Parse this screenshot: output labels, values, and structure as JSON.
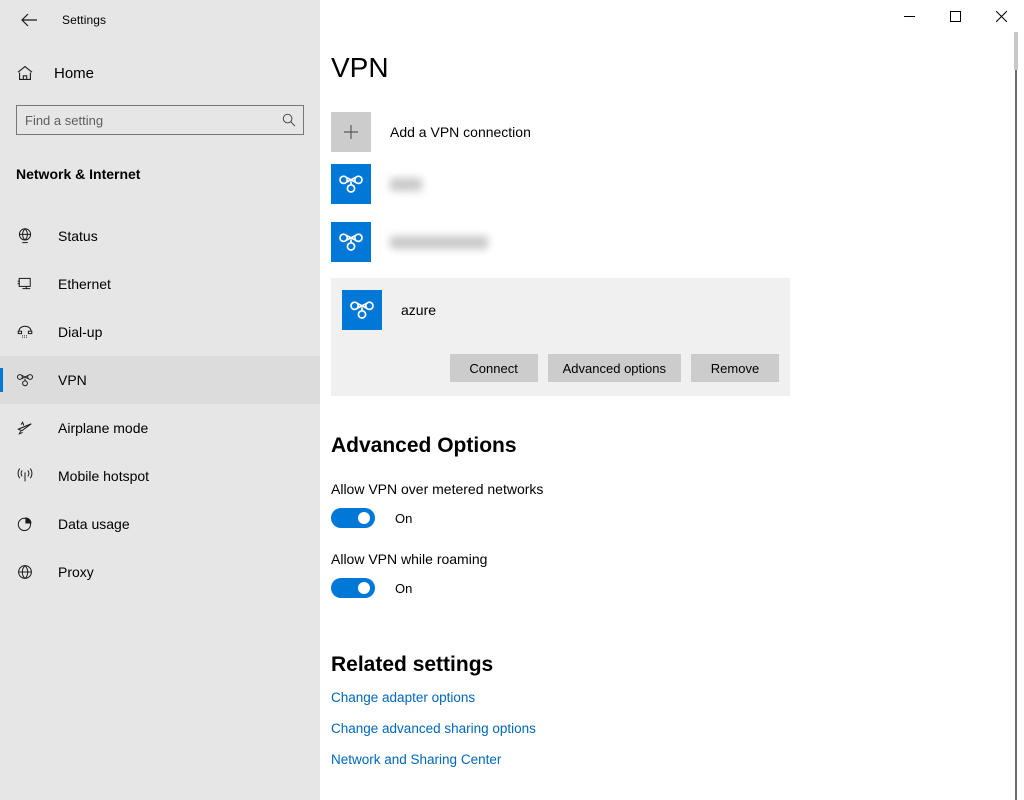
{
  "window": {
    "app_title": "Settings",
    "back_icon": "back-arrow-icon",
    "controls": {
      "minimize_label": "Minimize",
      "maximize_label": "Maximize",
      "close_label": "Close"
    }
  },
  "sidebar": {
    "home": {
      "label": "Home",
      "icon": "home-icon"
    },
    "search": {
      "placeholder": "Find a setting",
      "value": "",
      "icon": "search-icon"
    },
    "category": "Network & Internet",
    "items": [
      {
        "label": "Status",
        "icon": "status-globe-icon",
        "selected": false
      },
      {
        "label": "Ethernet",
        "icon": "ethernet-icon",
        "selected": false
      },
      {
        "label": "Dial-up",
        "icon": "dialup-phone-icon",
        "selected": false
      },
      {
        "label": "VPN",
        "icon": "vpn-knot-icon",
        "selected": true
      },
      {
        "label": "Airplane mode",
        "icon": "airplane-icon",
        "selected": false
      },
      {
        "label": "Mobile hotspot",
        "icon": "hotspot-signal-icon",
        "selected": false
      },
      {
        "label": "Data usage",
        "icon": "pie-chart-icon",
        "selected": false
      },
      {
        "label": "Proxy",
        "icon": "globe-icon",
        "selected": false
      }
    ]
  },
  "main": {
    "page_title": "VPN",
    "add_connection": {
      "label": "Add a VPN connection",
      "icon": "plus-icon"
    },
    "connections": [
      {
        "name": "",
        "redacted": true,
        "icon": "vpn-knot-icon",
        "selected": false
      },
      {
        "name": "",
        "redacted": true,
        "icon": "vpn-knot-icon",
        "selected": false
      },
      {
        "name": "azure",
        "redacted": false,
        "icon": "vpn-knot-icon",
        "selected": true
      }
    ],
    "selected_actions": {
      "connect": "Connect",
      "advanced_options": "Advanced options",
      "remove": "Remove"
    },
    "advanced_options": {
      "title": "Advanced Options",
      "toggles": [
        {
          "label": "Allow VPN over metered networks",
          "state": "On",
          "on": true
        },
        {
          "label": "Allow VPN while roaming",
          "state": "On",
          "on": true
        }
      ]
    },
    "related_settings": {
      "title": "Related settings",
      "links": [
        "Change adapter options",
        "Change advanced sharing options",
        "Network and Sharing Center"
      ]
    }
  },
  "colors": {
    "accent": "#0078d7",
    "link": "#0067c0",
    "sidebar_bg": "#e6e6e6",
    "selected_row_bg": "#f0f0f0",
    "button_bg": "#cccccc"
  }
}
